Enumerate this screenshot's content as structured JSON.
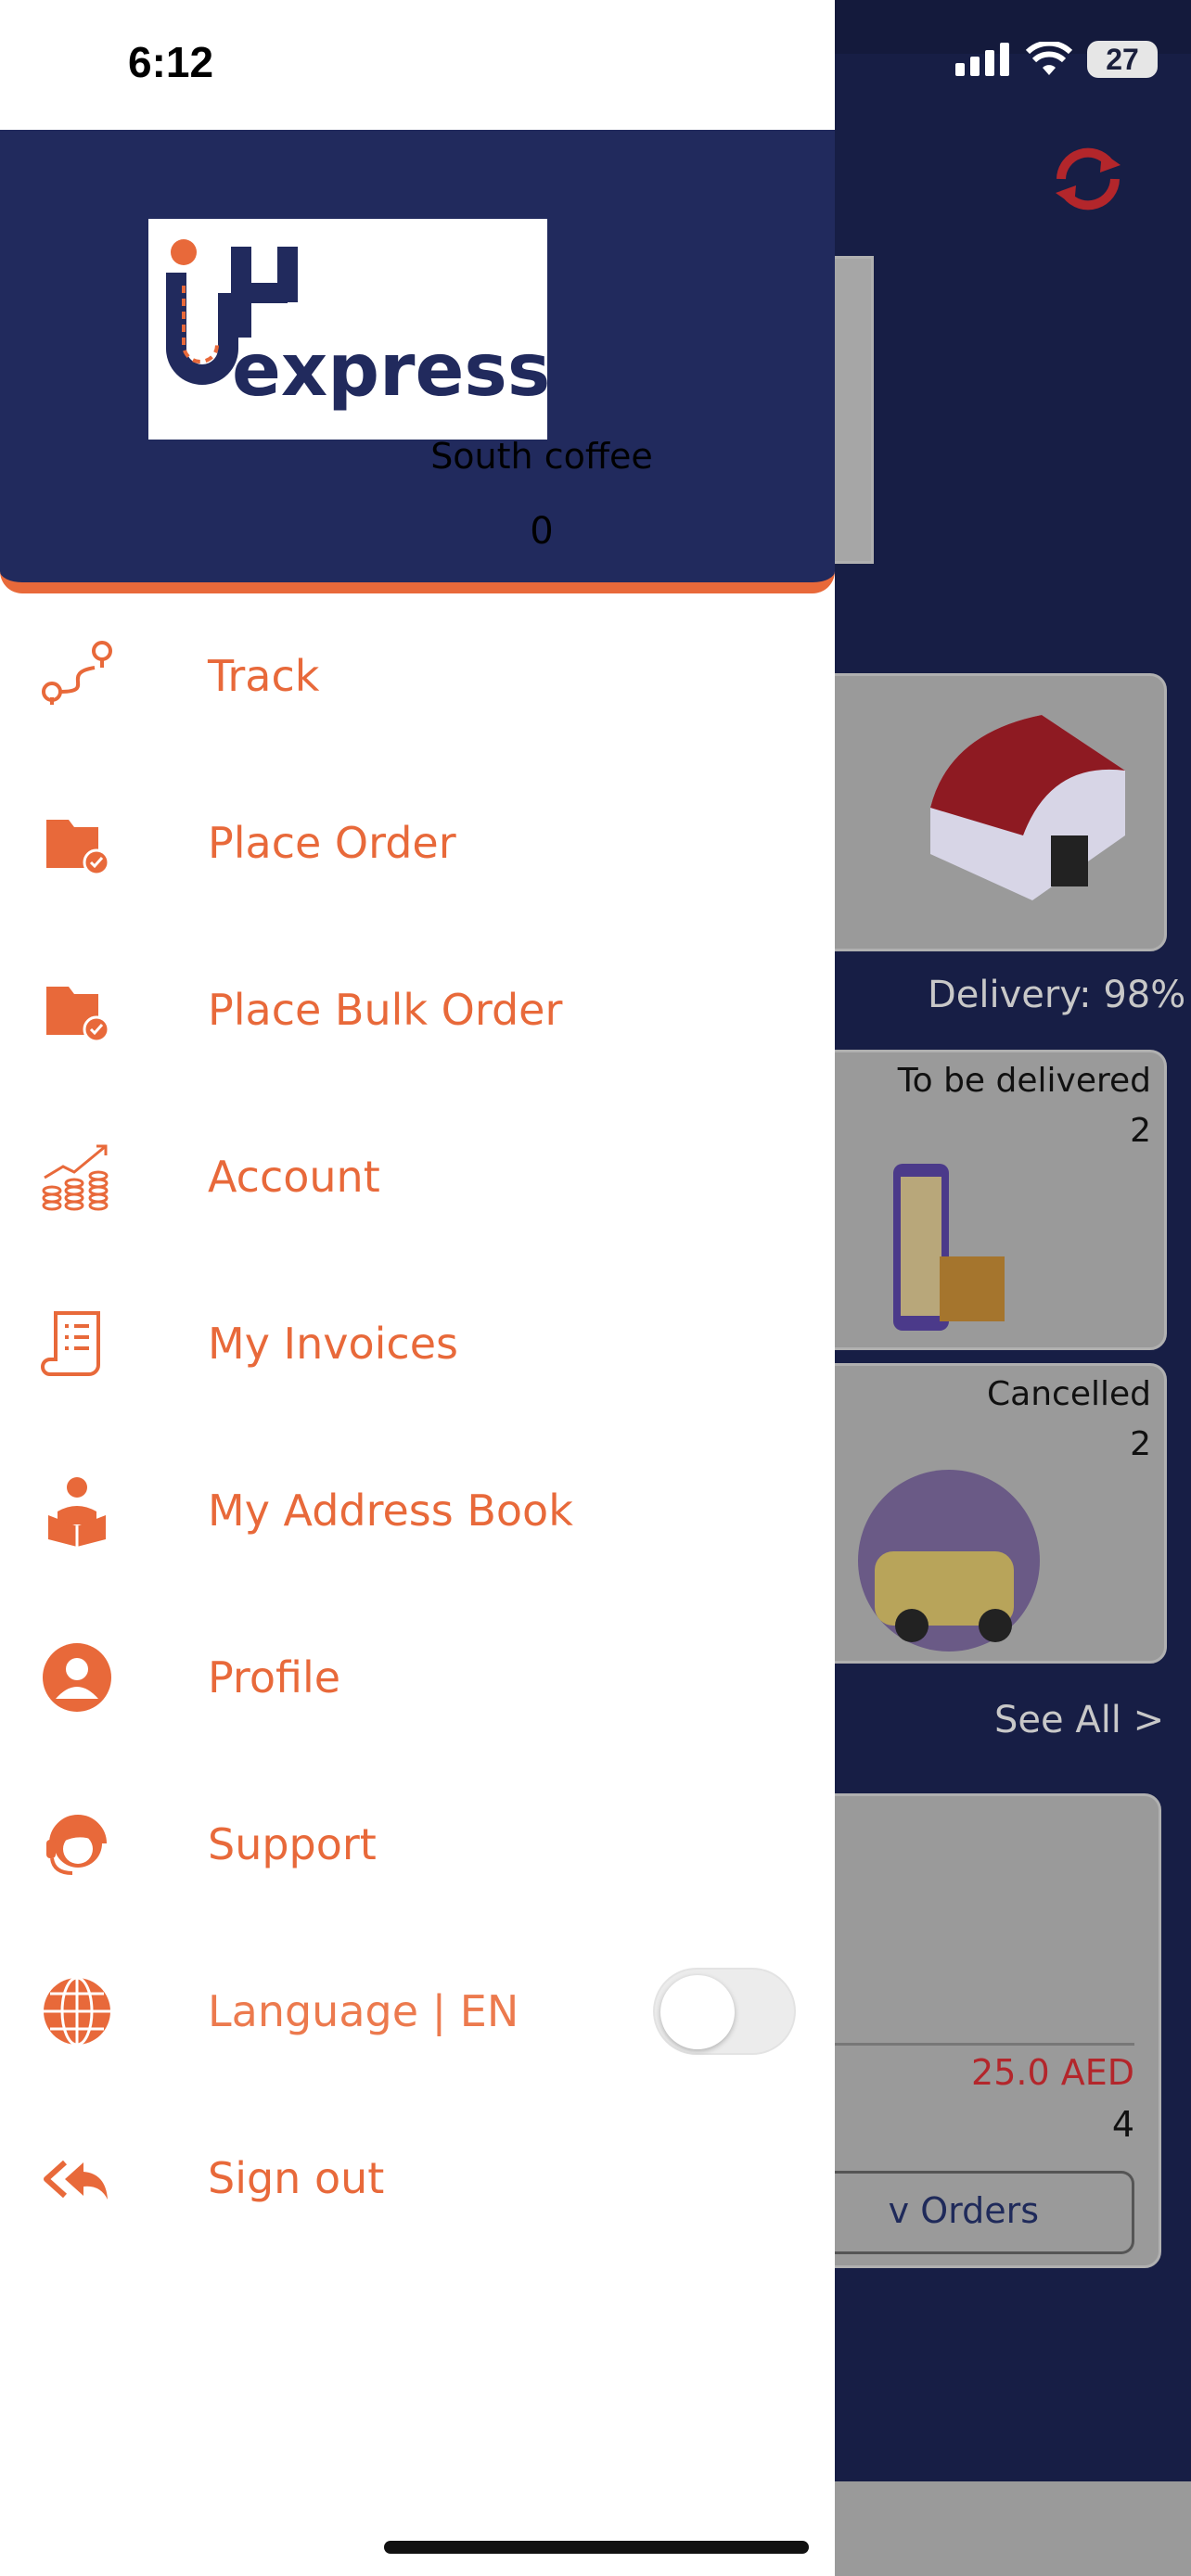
{
  "status": {
    "time": "6:12",
    "battery": "27"
  },
  "drawer": {
    "logo_text": "iHexpress",
    "user_name": "South coffee",
    "user_count": "0",
    "menu": [
      {
        "label": "Track",
        "icon": "route-icon"
      },
      {
        "label": "Place Order",
        "icon": "folder-check-icon"
      },
      {
        "label": "Place Bulk Order",
        "icon": "folder-check-icon"
      },
      {
        "label": "Account",
        "icon": "growth-coins-icon"
      },
      {
        "label": "My Invoices",
        "icon": "invoice-icon"
      },
      {
        "label": "My Address Book",
        "icon": "reader-icon"
      },
      {
        "label": "Profile",
        "icon": "user-icon"
      },
      {
        "label": "Support",
        "icon": "headset-icon"
      },
      {
        "label": "Language | EN",
        "icon": "globe-icon"
      },
      {
        "label": "Sign out",
        "icon": "reply-all-icon"
      }
    ],
    "language_toggle_on": false
  },
  "background": {
    "delivery_rate": "Delivery: 98%",
    "to_be_delivered_label": "To be delivered",
    "to_be_delivered_count": "2",
    "cancelled_label": "Cancelled",
    "cancelled_count": "2",
    "see_all": "See All >",
    "amount": "25.0 AED",
    "orders_count": "4",
    "view_orders": "v Orders"
  },
  "colors": {
    "accent": "#e8693a",
    "header": "#212a5d",
    "background": "#171e45"
  }
}
